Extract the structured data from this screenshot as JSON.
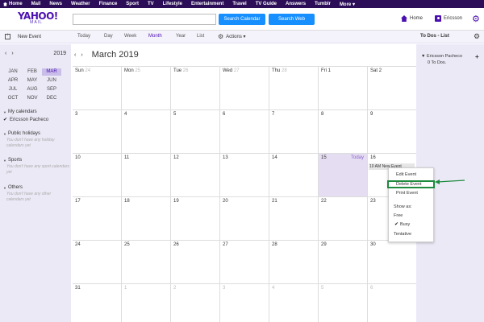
{
  "topnav": [
    {
      "label": "Home"
    },
    {
      "label": "Mail"
    },
    {
      "label": "News"
    },
    {
      "label": "Weather"
    },
    {
      "label": "Finance"
    },
    {
      "label": "Sport"
    },
    {
      "label": "TV"
    },
    {
      "label": "Lifestyle"
    },
    {
      "label": "Entertainment"
    },
    {
      "label": "Travel"
    },
    {
      "label": "TV Guide"
    },
    {
      "label": "Answers"
    },
    {
      "label": "Tumblr"
    },
    {
      "label": "More ▾"
    }
  ],
  "header": {
    "logo_main": "YAHOO!",
    "logo_sub": "MAIL",
    "search_value": "",
    "search_calendar_label": "Search Calendar",
    "search_web_label": "Search Web",
    "home_label": "Home",
    "user_name": "Ericsson"
  },
  "toolbar": {
    "new_event_label": "New Event",
    "views": [
      "Today",
      "Day",
      "Week",
      "Month",
      "Year",
      "List"
    ],
    "active_view": "Month",
    "actions_label": "Actions ▾",
    "todos_title": "To Dos - List"
  },
  "mini_calendar": {
    "year": "2019",
    "months": [
      "JAN",
      "FEB",
      "MAR",
      "APR",
      "MAY",
      "JUN",
      "JUL",
      "AUG",
      "SEP",
      "OCT",
      "NOV",
      "DEC"
    ],
    "selected": "MAR"
  },
  "sidebar": {
    "my_calendars": {
      "title": "My calendars",
      "items": [
        "Ericsson Pacheco"
      ]
    },
    "public_holidays": {
      "title": "Public holidays",
      "note": "You don't have any holiday calendars yet"
    },
    "sports": {
      "title": "Sports",
      "note": "You don't have any sport calendars yet"
    },
    "others": {
      "title": "Others",
      "note": "You don't have any other calendars yet"
    }
  },
  "calendar": {
    "title": "March 2019",
    "today_label": "Today",
    "weeks": [
      [
        {
          "n": "Sun",
          "d": "24",
          "faded": true
        },
        {
          "n": "Mon",
          "d": "25",
          "faded": true
        },
        {
          "n": "Tue",
          "d": "26",
          "faded": true
        },
        {
          "n": "Wed",
          "d": "27",
          "faded": true
        },
        {
          "n": "Thu",
          "d": "28",
          "faded": true
        },
        {
          "n": "Fri",
          "d": "1",
          "faded": false
        },
        {
          "n": "Sat",
          "d": "2",
          "faded": false
        }
      ],
      [
        {
          "d": "3"
        },
        {
          "d": "4"
        },
        {
          "d": "5"
        },
        {
          "d": "6"
        },
        {
          "d": "7"
        },
        {
          "d": "8"
        },
        {
          "d": "9"
        }
      ],
      [
        {
          "d": "10"
        },
        {
          "d": "11"
        },
        {
          "d": "12"
        },
        {
          "d": "13"
        },
        {
          "d": "14"
        },
        {
          "d": "15",
          "today": true
        },
        {
          "d": "16",
          "event": "10 AM New Event"
        }
      ],
      [
        {
          "d": "17"
        },
        {
          "d": "18"
        },
        {
          "d": "19"
        },
        {
          "d": "20"
        },
        {
          "d": "21"
        },
        {
          "d": "22"
        },
        {
          "d": "23"
        }
      ],
      [
        {
          "d": "24"
        },
        {
          "d": "25"
        },
        {
          "d": "26"
        },
        {
          "d": "27"
        },
        {
          "d": "28"
        },
        {
          "d": "29"
        },
        {
          "d": "30"
        }
      ],
      [
        {
          "d": "31"
        },
        {
          "d": "1",
          "faded": true
        },
        {
          "d": "2",
          "faded": true
        },
        {
          "d": "3",
          "faded": true
        },
        {
          "d": "4",
          "faded": true
        },
        {
          "d": "5",
          "faded": true
        },
        {
          "d": "6",
          "faded": true
        }
      ]
    ]
  },
  "context_menu": {
    "edit": "Edit Event",
    "delete": "Delete Event",
    "print": "Print Event",
    "show_as": "Show as:",
    "free": "Free",
    "busy": "Busy",
    "tentative": "Tentative"
  },
  "todos": {
    "user": "Ericsson Pacheco",
    "count": "0 To Dos."
  },
  "colors": {
    "brand": "#4b0fb0",
    "topnav": "#2b0e57",
    "button_blue": "#188fff",
    "today_bg": "#e5ddf2",
    "highlight_green": "#1d8a3e"
  }
}
